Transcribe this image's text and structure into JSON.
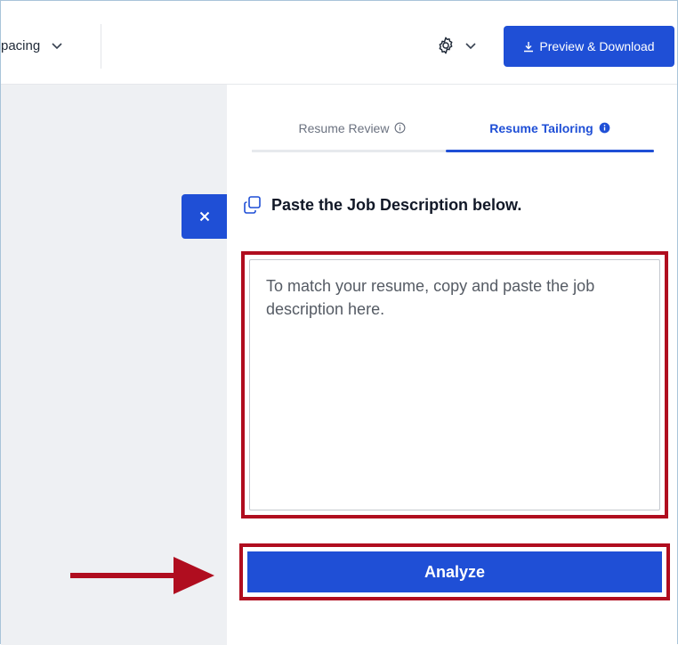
{
  "toolbar": {
    "spacing_label": "pacing",
    "download_label": "Preview & Download"
  },
  "panel": {
    "tabs": [
      {
        "label": "Resume Review",
        "active": false
      },
      {
        "label": "Resume Tailoring",
        "active": true
      }
    ],
    "heading": "Paste the Job Description below.",
    "job_description": {
      "value": "",
      "placeholder": "To match your resume, copy and paste the job description here."
    },
    "analyze_label": "Analyze"
  },
  "colors": {
    "primary": "#1f4fd6",
    "highlight": "#b00d1f",
    "sidebar_bg": "#eef0f3"
  },
  "icons": [
    "chevron-down-icon",
    "gear-icon",
    "download-icon",
    "close-icon",
    "info-icon",
    "copy-icon",
    "arrow-right-icon"
  ]
}
